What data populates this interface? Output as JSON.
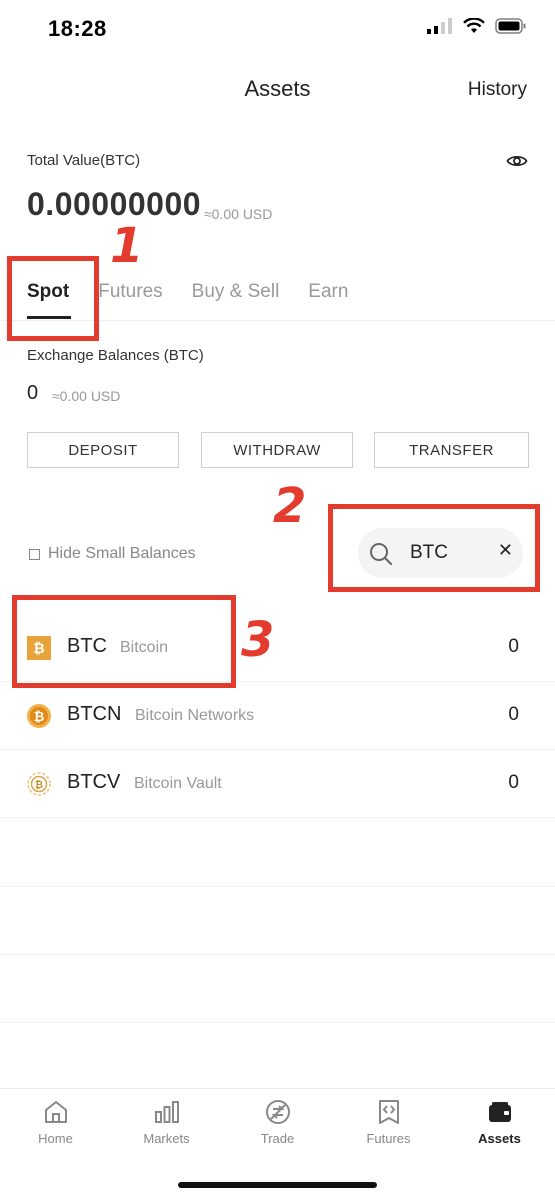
{
  "status_bar": {
    "time": "18:28"
  },
  "header": {
    "title": "Assets",
    "history": "History"
  },
  "total": {
    "label": "Total Value(BTC)",
    "value": "0.00000000",
    "usd": "≈0.00 USD"
  },
  "tabs": [
    {
      "label": "Spot",
      "active": true
    },
    {
      "label": "Futures",
      "active": false
    },
    {
      "label": "Buy & Sell",
      "active": false
    },
    {
      "label": "Earn",
      "active": false
    }
  ],
  "exchange": {
    "label": "Exchange Balances (BTC)",
    "value": "0",
    "usd": "≈0.00 USD"
  },
  "actions": {
    "deposit": "DEPOSIT",
    "withdraw": "WITHDRAW",
    "transfer": "TRANSFER"
  },
  "filter": {
    "hide_small_label": "Hide Small Balances",
    "hide_small_checked": false
  },
  "search": {
    "value": "BTC",
    "clear_icon": "close-icon"
  },
  "coins": [
    {
      "symbol": "BTC",
      "name": "Bitcoin",
      "balance": "0",
      "icon": "btc-icon"
    },
    {
      "symbol": "BTCN",
      "name": "Bitcoin Networks",
      "balance": "0",
      "icon": "btcn-icon"
    },
    {
      "symbol": "BTCV",
      "name": "Bitcoin Vault",
      "balance": "0",
      "icon": "btcv-icon"
    }
  ],
  "annotations": {
    "n1": "1",
    "n2": "2",
    "n3": "3",
    "color": "#e33b2e"
  },
  "bottom_nav": [
    {
      "label": "Home",
      "icon": "home-icon",
      "active": false
    },
    {
      "label": "Markets",
      "icon": "markets-icon",
      "active": false
    },
    {
      "label": "Trade",
      "icon": "trade-icon",
      "active": false
    },
    {
      "label": "Futures",
      "icon": "futures-icon",
      "active": false
    },
    {
      "label": "Assets",
      "icon": "wallet-icon",
      "active": true
    }
  ],
  "colors": {
    "accent_orange": "#e8a33a",
    "annotation_red": "#e33b2e"
  }
}
